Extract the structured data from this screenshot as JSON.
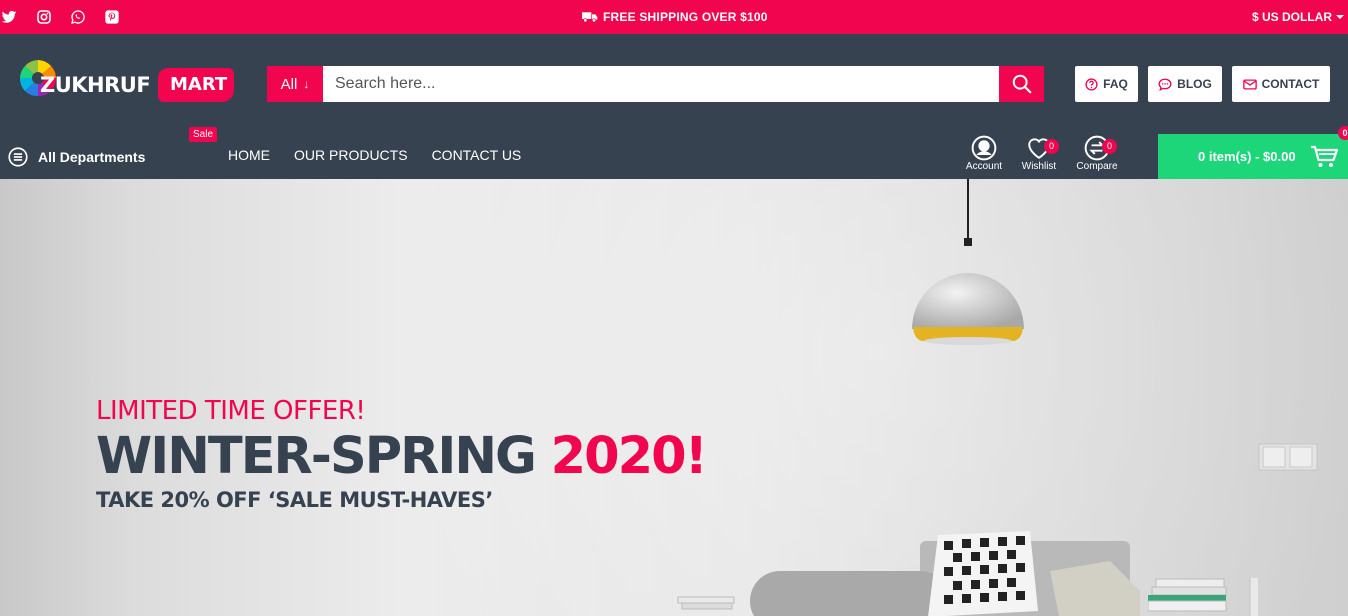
{
  "topbar": {
    "social": [
      "twitter-icon",
      "instagram-icon",
      "whatsapp-icon",
      "pinterest-icon"
    ],
    "shipping_text": "FREE SHIPPING OVER $100",
    "currency": "$ US DOLLAR"
  },
  "header": {
    "logo_main": "ZUKHRUF",
    "logo_badge": "MART",
    "search": {
      "category": "All",
      "placeholder": "Search here..."
    },
    "buttons": {
      "faq": "FAQ",
      "blog": "BLOG",
      "contact": "CONTACT"
    }
  },
  "nav": {
    "departments": "All Departments",
    "sale_tag": "Sale",
    "links": [
      "HOME",
      "OUR PRODUCTS",
      "CONTACT US"
    ]
  },
  "user": {
    "account": "Account",
    "wishlist": "Wishlist",
    "wishlist_count": "0",
    "compare": "Compare",
    "compare_count": "0"
  },
  "cart": {
    "summary": "0 item(s) - $0.00",
    "count": "0"
  },
  "hero": {
    "offer": "LIMITED TIME OFFER!",
    "headline": "WINTER-SPRING",
    "headline_highlight": "2020!",
    "subline": "TAKE 20% OFF ‘SALE MUST-HAVES’"
  },
  "colors": {
    "primary": "#f0054e",
    "header_bg": "#374250",
    "cart_bg": "#1ed67a"
  }
}
